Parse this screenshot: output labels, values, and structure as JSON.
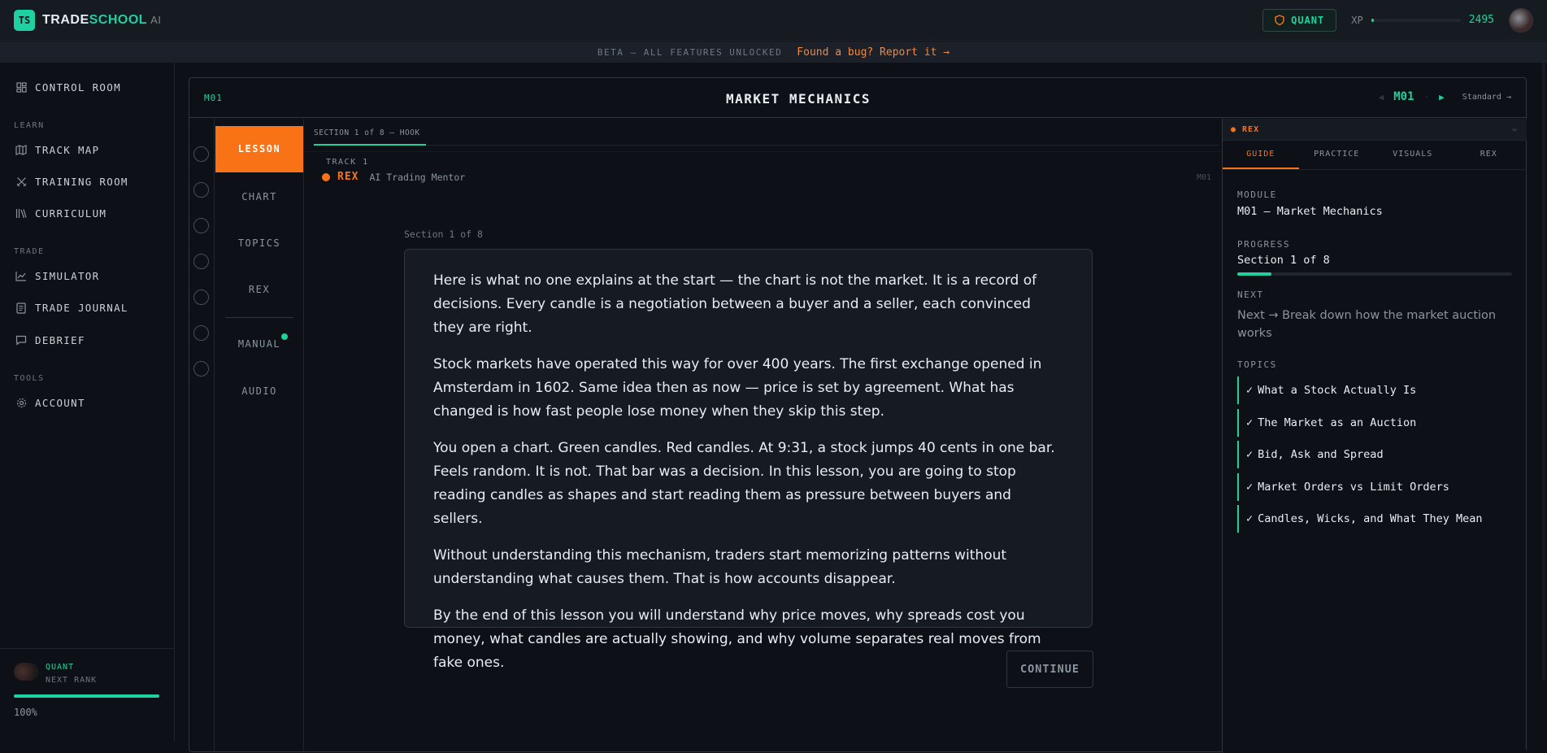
{
  "brand": {
    "logo": "TS",
    "name_part1": "TRADE",
    "name_part2": "SCHOOL",
    "name_part3": "AI"
  },
  "topbar": {
    "rank": "QUANT",
    "xp_label": "XP",
    "xp_value": "2495",
    "xp_progress": 0.03
  },
  "beta": {
    "notice": "BETA — ALL FEATURES UNLOCKED",
    "bug_link": "Found a bug? Report it →"
  },
  "sidebar": {
    "control_room": "CONTROL ROOM",
    "section_learn": "LEARN",
    "track_map": "TRACK MAP",
    "training_room": "TRAINING ROOM",
    "curriculum": "CURRICULUM",
    "section_trade": "TRADE",
    "simulator": "SIMULATOR",
    "trade_journal": "TRADE JOURNAL",
    "debrief": "DEBRIEF",
    "section_tools": "TOOLS",
    "account": "ACCOUNT",
    "rank_name": "QUANT",
    "rank_next": "NEXT RANK",
    "rank_pct": "100%",
    "rank_progress": 1.0
  },
  "module": {
    "code": "M01",
    "title": "MARKET MECHANICS",
    "nav_prev": "◀",
    "nav_current": "M01",
    "nav_dot": "·",
    "nav_next": "▶",
    "mode": "Standard →"
  },
  "lesson_tabs": {
    "lesson": "LESSON",
    "chart": "CHART",
    "topics": "TOPICS",
    "rex": "REX",
    "manual": "MANUAL",
    "audio": "AUDIO"
  },
  "content": {
    "section_tab": "SECTION 1 of 8 — HOOK",
    "track": "TRACK 1",
    "mentor_name": "REX",
    "mentor_role": "AI Trading Mentor",
    "module_code": "M01",
    "section_label": "Section 1 of 8",
    "paragraphs": [
      "Here is what no one explains at the start — the chart is not the market. It is a record of decisions. Every candle is a negotiation between a buyer and a seller, each convinced they are right.",
      "Stock markets have operated this way for over 400 years. The first exchange opened in Amsterdam in 1602. Same idea then as now — price is set by agreement. What has changed is how fast people lose money when they skip this step.",
      "You open a chart. Green candles. Red candles. At 9:31, a stock jumps 40 cents in one bar. Feels random. It is not. That bar was a decision. In this lesson, you are going to stop reading candles as shapes and start reading them as pressure between buyers and sellers.",
      "Without understanding this mechanism, traders start memorizing patterns without understanding what causes them. That is how accounts disappear.",
      "By the end of this lesson you will understand why price moves, why spreads cost you money, what candles are actually showing, and why volume separates real moves from fake ones."
    ],
    "continue": "CONTINUE"
  },
  "panel": {
    "header": "● REX",
    "chevron": "⌵",
    "tabs": [
      "GUIDE",
      "PRACTICE",
      "VISUALS",
      "REX"
    ],
    "module_label": "MODULE",
    "module_value": "M01 — Market Mechanics",
    "progress_label": "PROGRESS",
    "progress_value": "Section 1 of 8",
    "progress": 0.125,
    "next_label": "NEXT",
    "next_value": "Next → Break down how the market auction works",
    "topics_label": "TOPICS",
    "topics": [
      "What a Stock Actually Is",
      "The Market as an Auction",
      "Bid, Ask and Spread",
      "Market Orders vs Limit Orders",
      "Candles, Wicks, and What They Mean"
    ]
  }
}
